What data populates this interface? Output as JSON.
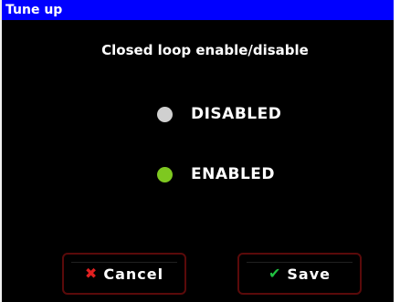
{
  "window": {
    "title": "Tune up",
    "subtitle": "Closed loop enable/disable"
  },
  "options": [
    {
      "label": "DISABLED",
      "selected": false,
      "indicator_color": "#d0d0d0",
      "icon": "radio-off-icon"
    },
    {
      "label": "ENABLED",
      "selected": true,
      "indicator_color": "#7ec820",
      "icon": "radio-on-icon"
    }
  ],
  "buttons": {
    "cancel": {
      "label": "Cancel",
      "icon": "cancel-x-icon",
      "icon_glyph": "✖",
      "icon_color": "#e02020"
    },
    "save": {
      "label": "Save",
      "icon": "checkmark-icon",
      "icon_glyph": "✔",
      "icon_color": "#20c040"
    }
  },
  "colors": {
    "titlebar": "#0000ff",
    "background": "#000000",
    "button_border": "#5a0a0a"
  }
}
